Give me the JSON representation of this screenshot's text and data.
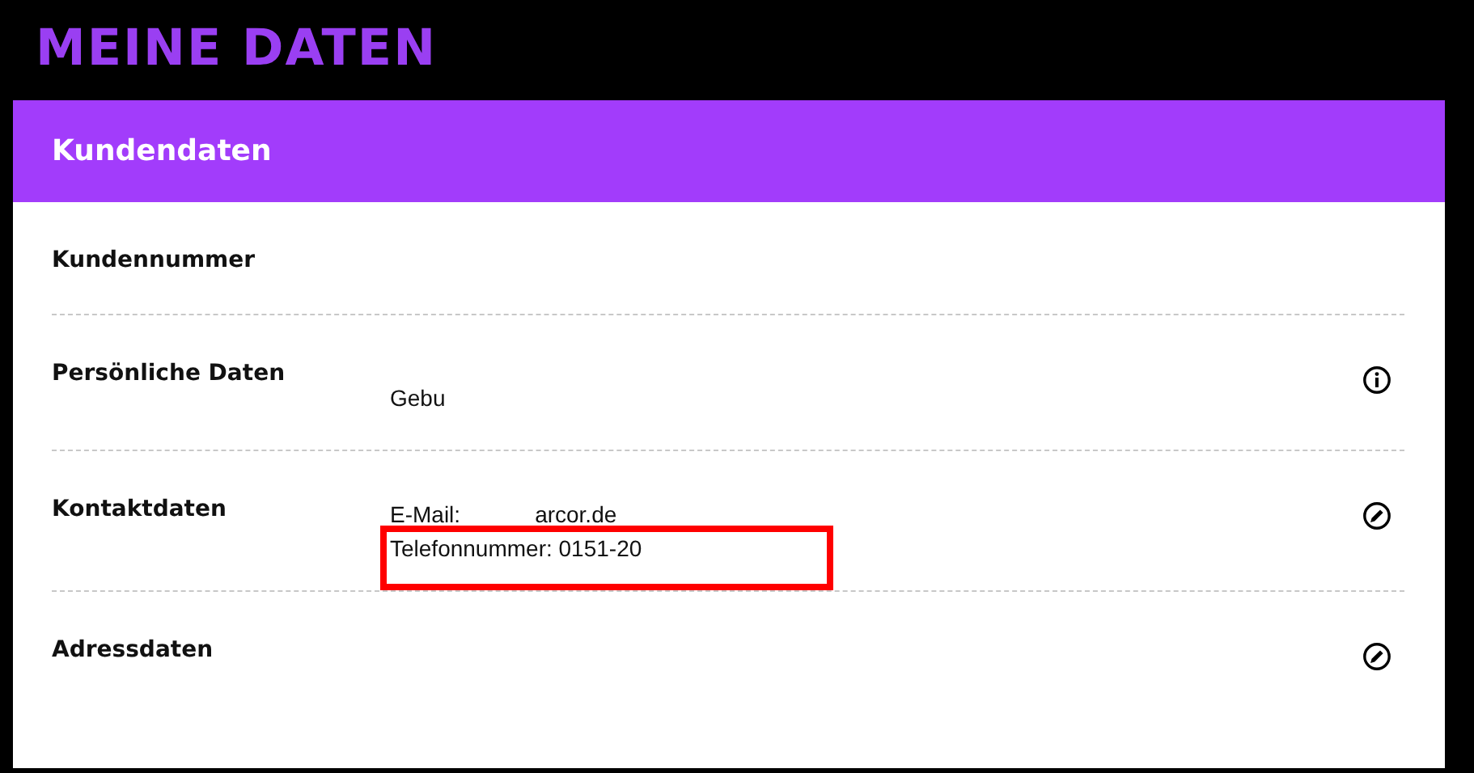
{
  "page_title": "MEINE DATEN",
  "card": {
    "title": "Kundendaten",
    "rows": [
      {
        "label": "Kundennummer",
        "lines": []
      },
      {
        "label": "Persönliche Daten",
        "lines": [
          {
            "text": "Gebu",
            "highlighted": false
          }
        ],
        "kind": "info"
      },
      {
        "label": "Kontaktdaten",
        "lines": [
          {
            "text": "E-Mail:",
            "value": "arcor.de",
            "highlighted": false
          },
          {
            "text": "Telefonnummer: 0151-20",
            "highlighted": true
          }
        ],
        "kind": "edit"
      },
      {
        "label": "Adressdaten",
        "lines": [],
        "kind": "edit"
      }
    ]
  }
}
